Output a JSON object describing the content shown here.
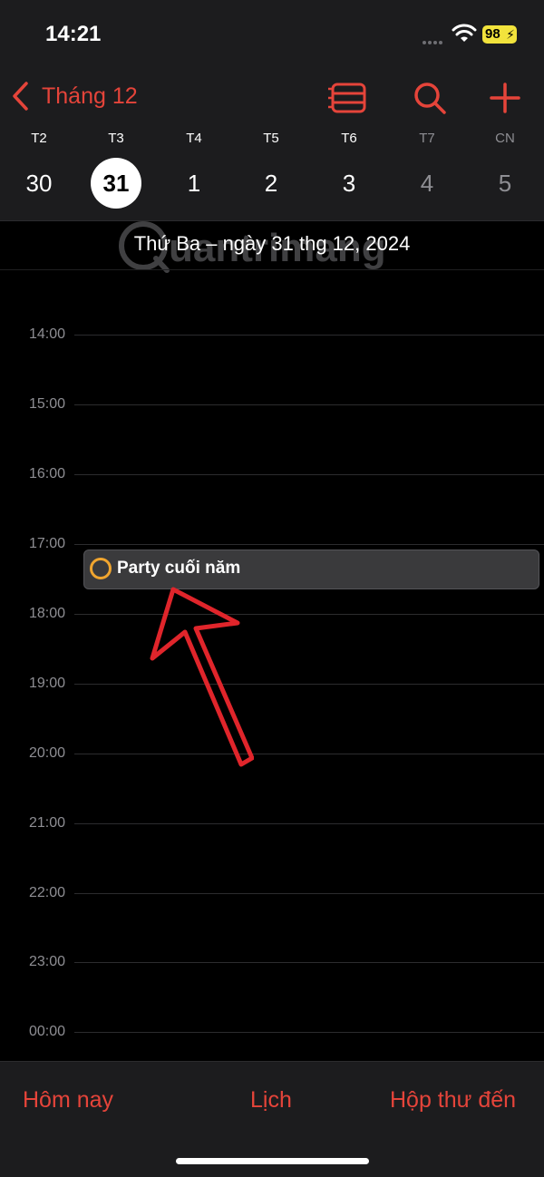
{
  "status": {
    "time": "14:21",
    "battery": "98"
  },
  "nav": {
    "back_label": "Tháng 12"
  },
  "week": {
    "days": [
      {
        "label": "T2",
        "date": "30",
        "dim": false,
        "selected": false
      },
      {
        "label": "T3",
        "date": "31",
        "dim": false,
        "selected": true
      },
      {
        "label": "T4",
        "date": "1",
        "dim": false,
        "selected": false
      },
      {
        "label": "T5",
        "date": "2",
        "dim": false,
        "selected": false
      },
      {
        "label": "T6",
        "date": "3",
        "dim": false,
        "selected": false
      },
      {
        "label": "T7",
        "date": "4",
        "dim": true,
        "selected": false
      },
      {
        "label": "CN",
        "date": "5",
        "dim": true,
        "selected": false
      }
    ]
  },
  "day_title": "Thứ Ba – ngày 31 thg 12, 2024",
  "watermark": "uantrimang",
  "hours": [
    "14:00",
    "15:00",
    "16:00",
    "17:00",
    "18:00",
    "19:00",
    "20:00",
    "21:00",
    "22:00",
    "23:00",
    "00:00"
  ],
  "event": {
    "title": "Party cuối năm",
    "color": "#f0a52f"
  },
  "tabs": {
    "today": "Hôm nay",
    "calendars": "Lịch",
    "inbox": "Hộp thư đến"
  },
  "colors": {
    "accent": "#e5443a",
    "background": "#000000",
    "bar": "#1c1c1e"
  }
}
